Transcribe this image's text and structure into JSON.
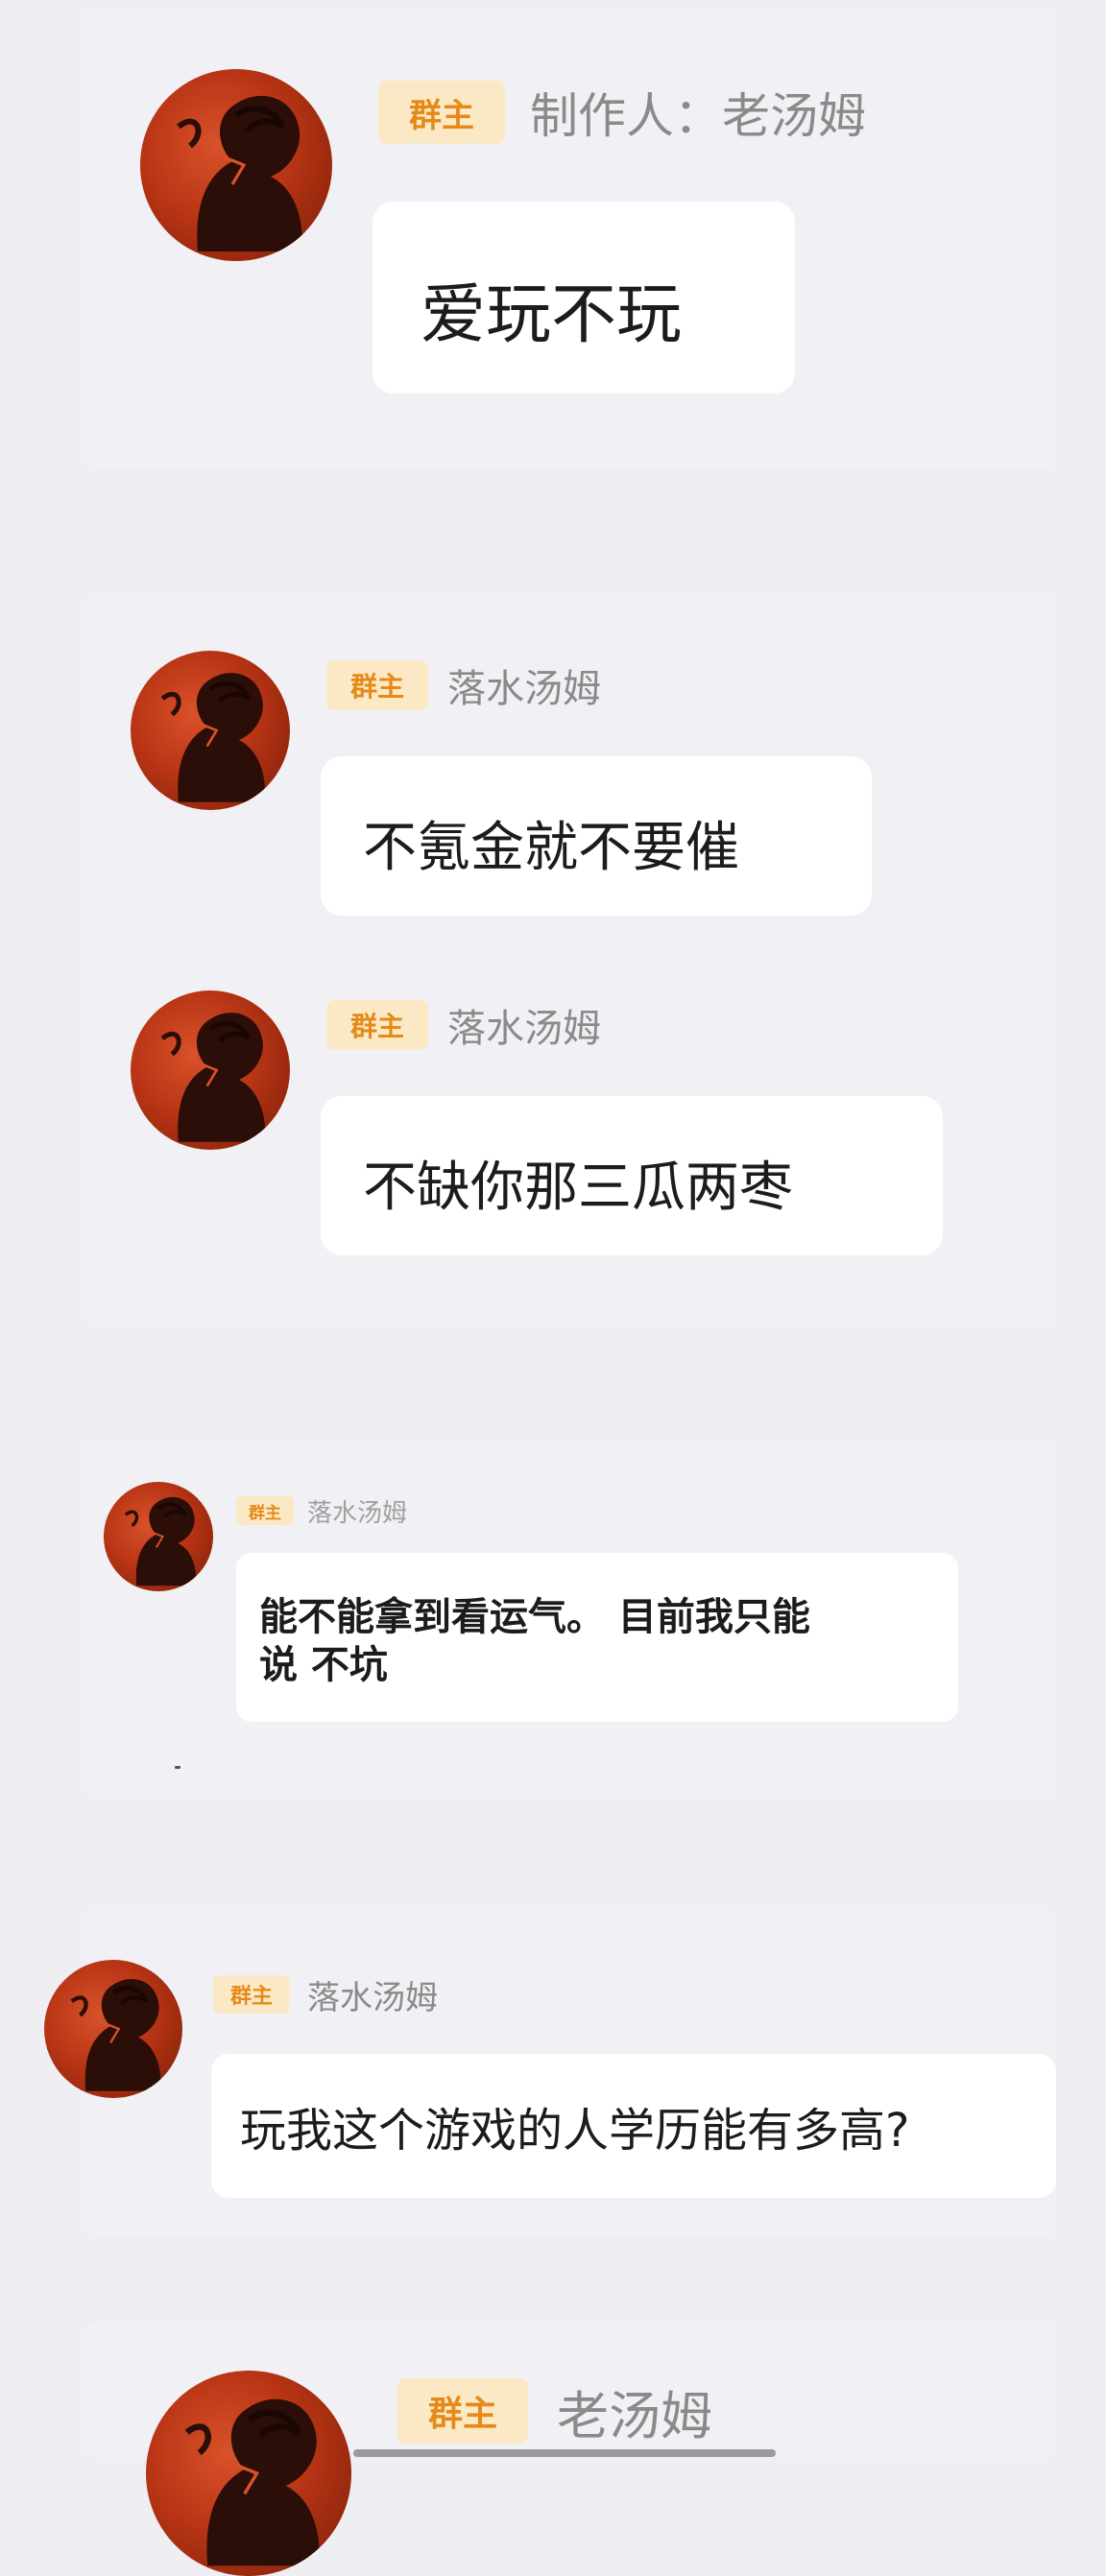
{
  "messages": [
    {
      "badge": "群主",
      "sender": "制作人：老汤姆",
      "text": "爱玩不玩"
    },
    {
      "badge": "群主",
      "sender": "落水汤姆",
      "text": "不氪金就不要催"
    },
    {
      "badge": "群主",
      "sender": "落水汤姆",
      "text": "不缺你那三瓜两枣"
    },
    {
      "badge": "群主",
      "sender": "落水汤姆",
      "text": "能不能拿到看运气。 目前我只能\n说 不坑"
    },
    {
      "badge": "群主",
      "sender": "落水汤姆",
      "text": "玩我这个游戏的人学历能有多高?"
    },
    {
      "badge": "群主",
      "sender": "老汤姆"
    }
  ],
  "icons": {
    "avatar": "cartoon-character-avatar-icon"
  },
  "colors": {
    "background": "#eeeef3",
    "bubble": "#ffffff",
    "badge_bg": "#fbe9c6",
    "badge_text": "#e58a19",
    "sender": "#8a8a8a",
    "avatar": "#b93515"
  }
}
